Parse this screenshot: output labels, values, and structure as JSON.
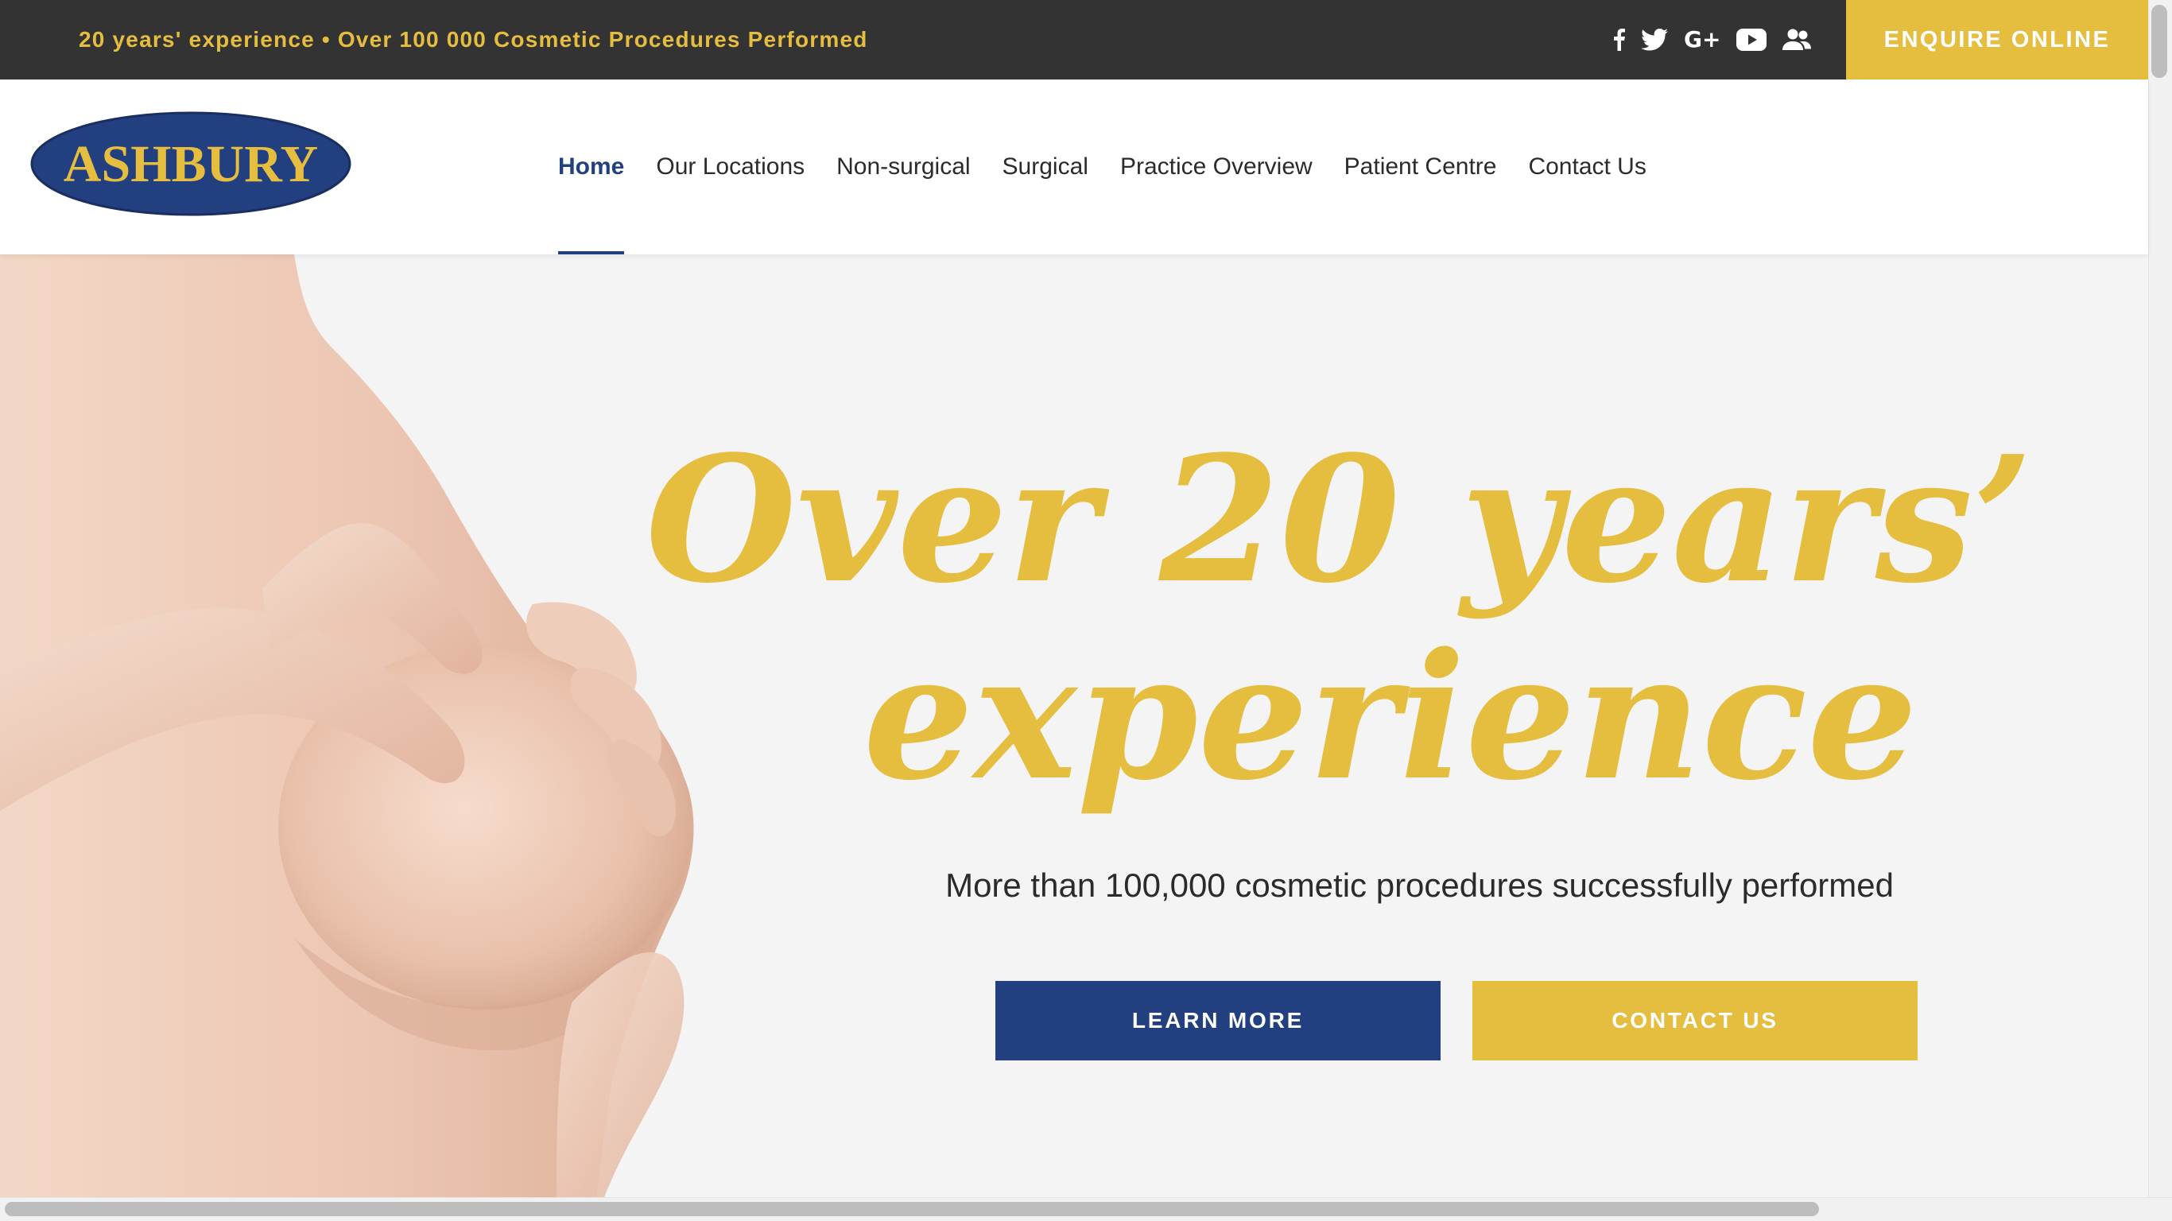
{
  "topbar": {
    "tagline": "20 years' experience • Over 100 000 Cosmetic Procedures Performed",
    "social_icons": [
      "facebook-icon",
      "twitter-icon",
      "google-plus-icon",
      "youtube-icon",
      "community-icon"
    ],
    "google_plus_text": "G+",
    "enquire_label": "ENQUIRE ONLINE"
  },
  "header": {
    "logo_text": "ASHBURY",
    "nav": [
      {
        "label": "Home",
        "active": true
      },
      {
        "label": "Our Locations"
      },
      {
        "label": "Non-surgical"
      },
      {
        "label": "Surgical"
      },
      {
        "label": "Practice Overview"
      },
      {
        "label": "Patient Centre"
      },
      {
        "label": "Contact Us"
      }
    ]
  },
  "hero": {
    "headline_line1": "Over 20 years’",
    "headline_line2": "experience",
    "subtitle": "More than 100,000 cosmetic procedures successfully performed",
    "learn_more_label": "LEARN MORE",
    "contact_label": "CONTACT US",
    "image_description": "hero-photo"
  },
  "colors": {
    "brand_navy": "#223f80",
    "brand_gold": "#e5bd3f",
    "topbar_bg": "#333333",
    "hero_bg": "#f4f4f4"
  }
}
